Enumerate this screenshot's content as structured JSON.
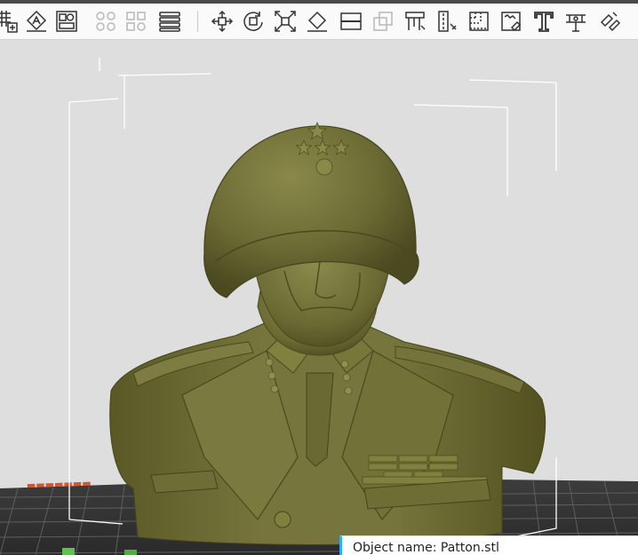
{
  "toolbar": {
    "items": [
      {
        "name": "add-object-icon"
      },
      {
        "name": "auto-orient-icon"
      },
      {
        "name": "arrange-icon"
      },
      {
        "name": "split-objects-icon"
      },
      {
        "name": "split-parts-icon"
      },
      {
        "name": "layers-menu-icon"
      },
      {
        "name": "move-icon"
      },
      {
        "name": "rotate-icon"
      },
      {
        "name": "scale-icon"
      },
      {
        "name": "lay-on-face-icon"
      },
      {
        "name": "cut-icon"
      },
      {
        "name": "mesh-boolean-icon"
      },
      {
        "name": "support-paint-icon"
      },
      {
        "name": "seam-paint-icon"
      },
      {
        "name": "color-paint-icon"
      },
      {
        "name": "fuzzy-skin-icon"
      },
      {
        "name": "text-tool-icon"
      },
      {
        "name": "measure-icon"
      },
      {
        "name": "assembly-icon"
      }
    ]
  },
  "colors": {
    "model": "#6b6a34",
    "bed_dark": "#3a3a3a",
    "bed_grid": "#6a6a6a",
    "accent": "#33aaff"
  },
  "object_info": {
    "label": "Object name: Patton.stl"
  }
}
